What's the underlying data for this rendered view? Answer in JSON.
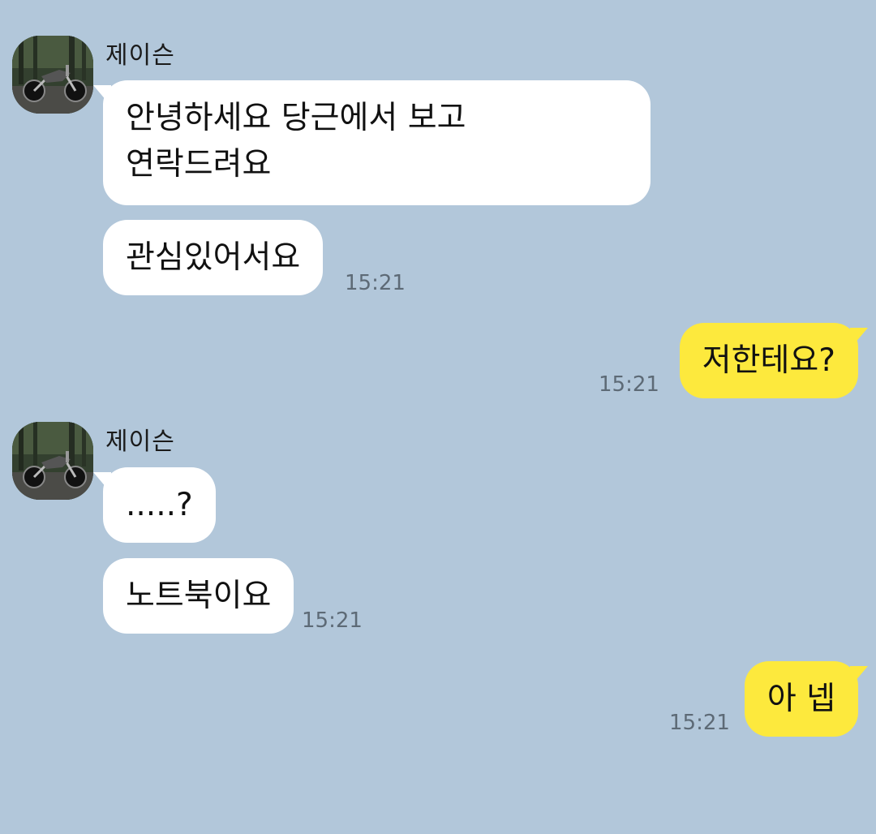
{
  "chat": {
    "messages": [
      {
        "sender": "제이슨",
        "avatar_icon": "motorcycle-icon",
        "bubbles": [
          {
            "lines": [
              "안녕하세요 당근에서 보고",
              "연락드려요"
            ]
          },
          {
            "lines": [
              "관심있어서요"
            ],
            "time": "15:21"
          }
        ]
      },
      {
        "from": "me",
        "bubbles": [
          {
            "lines": [
              "저한테요?"
            ],
            "time": "15:21"
          }
        ]
      },
      {
        "sender": "제이슨",
        "avatar_icon": "motorcycle-icon",
        "bubbles": [
          {
            "lines": [
              ".....?"
            ]
          },
          {
            "lines": [
              "노트북이요"
            ],
            "time": "15:21"
          }
        ]
      },
      {
        "from": "me",
        "bubbles": [
          {
            "lines": [
              "아 넵"
            ],
            "time": "15:21"
          }
        ]
      }
    ]
  },
  "colors": {
    "background": "#b2c7da",
    "incoming_bubble": "#ffffff",
    "outgoing_bubble": "#fde93d",
    "time_text": "#5d6a76"
  }
}
